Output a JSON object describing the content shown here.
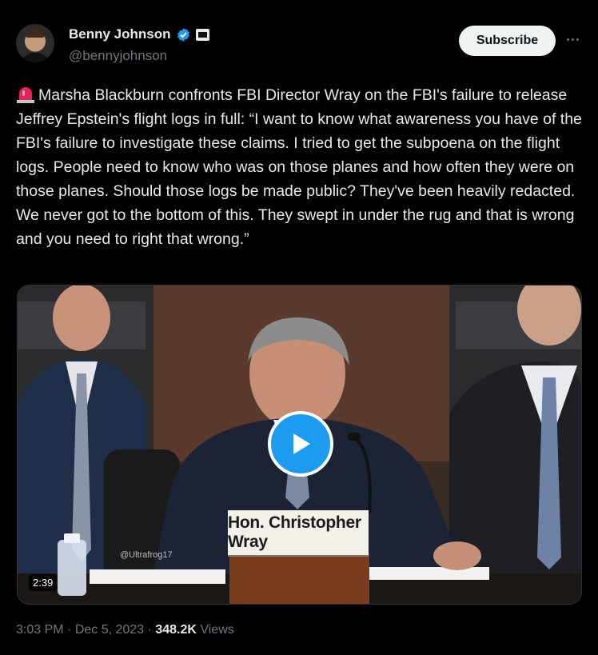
{
  "author": {
    "display_name": "Benny Johnson",
    "handle": "@bennyjohnson",
    "verified": true,
    "verified_color": "#1d9bf0"
  },
  "header": {
    "subscribe_label": "Subscribe",
    "more_icon": "more-horizontal-icon"
  },
  "tweet": {
    "emoji": "siren-icon",
    "text": "Marsha Blackburn confronts FBI Director Wray on the FBI's failure to release Jeffrey Epstein's flight logs in full: “I want to know what awareness you have of the FBI's failure to investigate these claims. I tried to get the subpoena on the flight logs. People need to know who was on those planes and how often they were on those planes. Should those logs be made public? They've been heavily redacted. We never got to the bottom of this. They swept in under the rug and that is wrong and you need to right that wrong.”"
  },
  "media": {
    "nameplate": "Hon. Christopher Wray",
    "watermark": "@Ultrafrog17",
    "duration": "2:39"
  },
  "meta": {
    "time": "3:03 PM",
    "sep1": " · ",
    "date": "Dec 5, 2023",
    "sep2": " · ",
    "views_count": "348.2K",
    "views_label": " Views"
  }
}
